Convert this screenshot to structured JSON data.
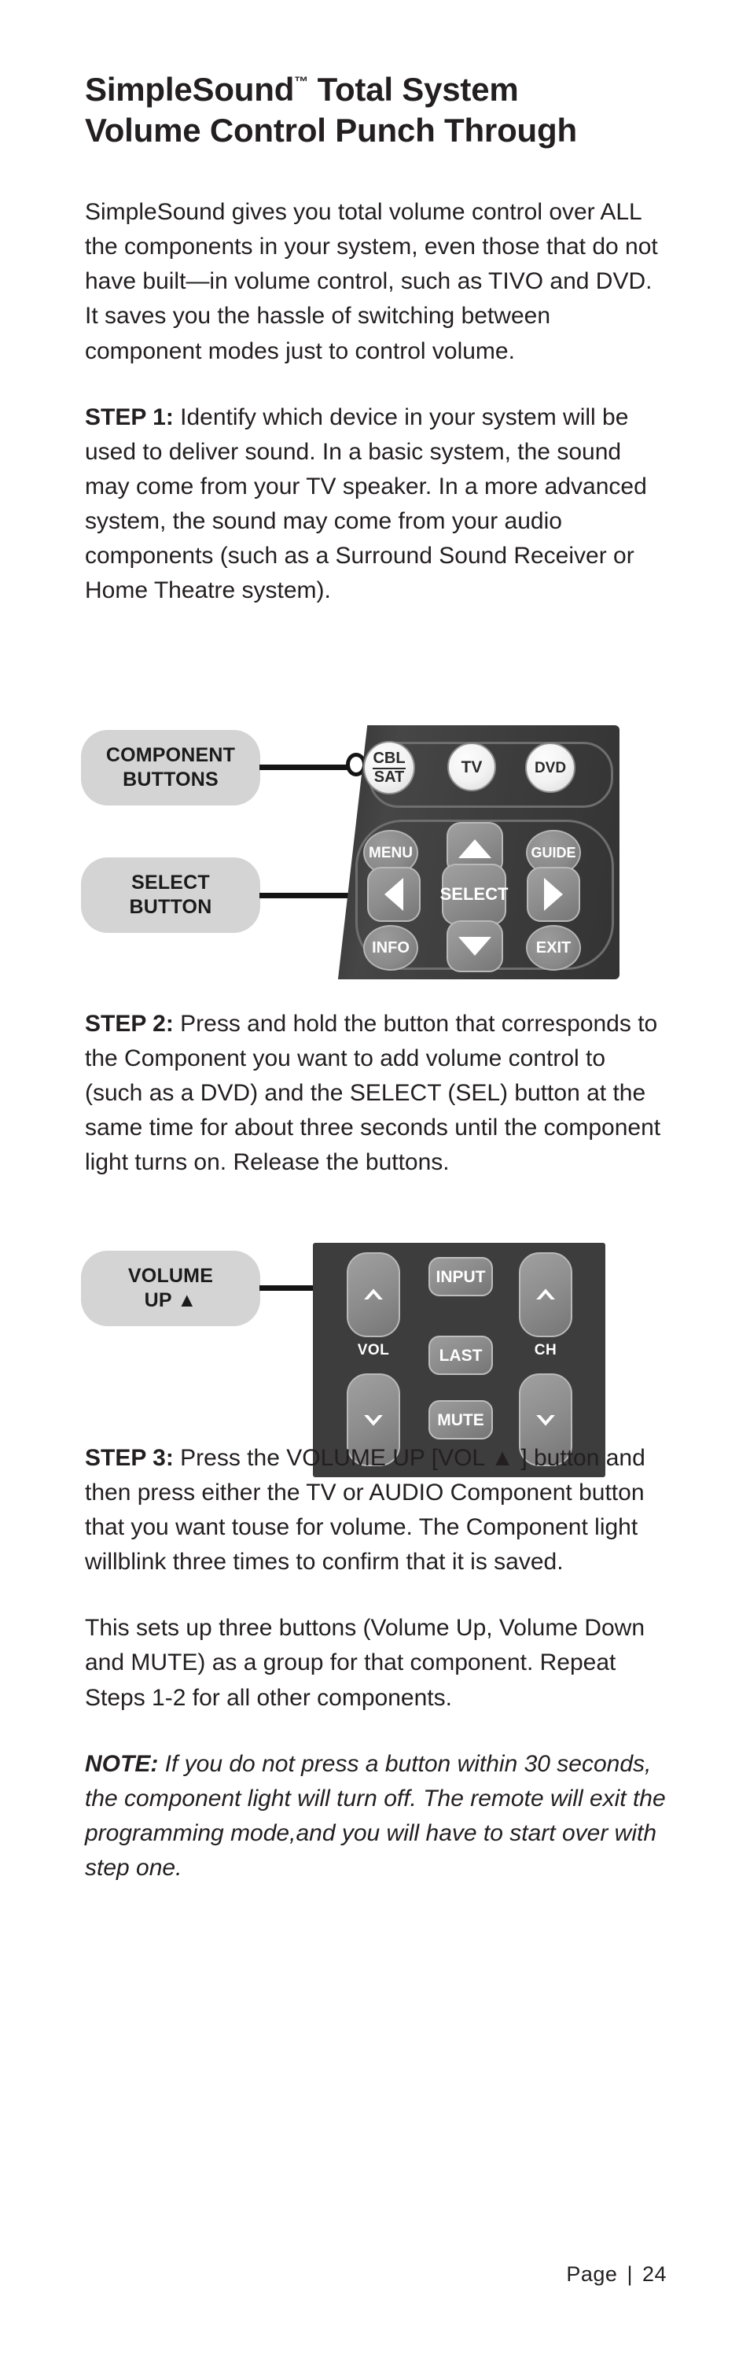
{
  "document": {
    "title_line1": "SimpleSound",
    "title_tm": "™",
    "title_line1_rest": " Total System",
    "title_line2": "Volume Control Punch Through"
  },
  "intro": {
    "text": "SimpleSound  gives you total volume control over ALL the components in your system, even those that do not have built—in volume control, such as TIVO and DVD. It saves you the hassle of switching between component modes just to control volume."
  },
  "steps": [
    {
      "lead": "STEP 1:",
      "text": " Identify which device in your system will be used to deliver sound. In a basic system, the sound may come from your TV speaker. In a more advanced system, the sound may come from your audio components (such as a Surround Sound Receiver or Home Theatre system)."
    },
    {
      "lead": "STEP 2:",
      "text": " Press and hold the button that corresponds to the Component you want to add volume control to (such as a DVD) and the SELECT (SEL) button at the same time for about three seconds until the component light turns on. Release the buttons."
    },
    {
      "lead": "STEP 3:",
      "text": " Press the VOLUME UP [VOL ▲ ] button and then press either the TV or AUDIO Component button that you want touse for volume. The Component light willblink three times to confirm that it is saved."
    }
  ],
  "summary": {
    "text": "This sets up three buttons (Volume Up, Volume Down and MUTE) as a group for that component. Repeat Steps 1-2 for all other components."
  },
  "note": {
    "lead": "NOTE:",
    "text": " If you do not press a button within 30 seconds, the component light will turn off. The remote will exit the programming mode,and you will have to start over with step one."
  },
  "figure_remote": {
    "callouts": [
      {
        "name": "component-buttons",
        "line1": "COMPONENT",
        "line2": "BUTTONS"
      },
      {
        "name": "select-button",
        "line1": "SELECT",
        "line2": "BUTTON"
      }
    ],
    "buttons": {
      "cbl": "CBL",
      "sat": "SAT",
      "tv": "TV",
      "dvd": "DVD",
      "menu": "MENU",
      "guide": "GUIDE",
      "select": "SELECT",
      "info": "INFO",
      "exit": "EXIT",
      "up_arrow": "▲",
      "down_arrow": "▼",
      "left_arrow": "◀",
      "right_arrow": "▶"
    }
  },
  "figure_volume": {
    "callout": {
      "name": "volume-up",
      "line1": "VOLUME",
      "line2": "UP ▲"
    },
    "buttons": {
      "input": "INPUT",
      "last": "LAST",
      "mute": "MUTE",
      "vol_label": "VOL",
      "ch_label": "CH",
      "vol_up": "⌃",
      "vol_down": "⌄",
      "ch_up": "⌃",
      "ch_down": "⌄"
    }
  },
  "footer": {
    "label": "Page",
    "separator": "|",
    "number": "24"
  },
  "colors": {
    "text": "#231f20",
    "callout_bg": "#d4d4d4",
    "remote_body": "#3c3c3c",
    "leader": "#141414"
  }
}
